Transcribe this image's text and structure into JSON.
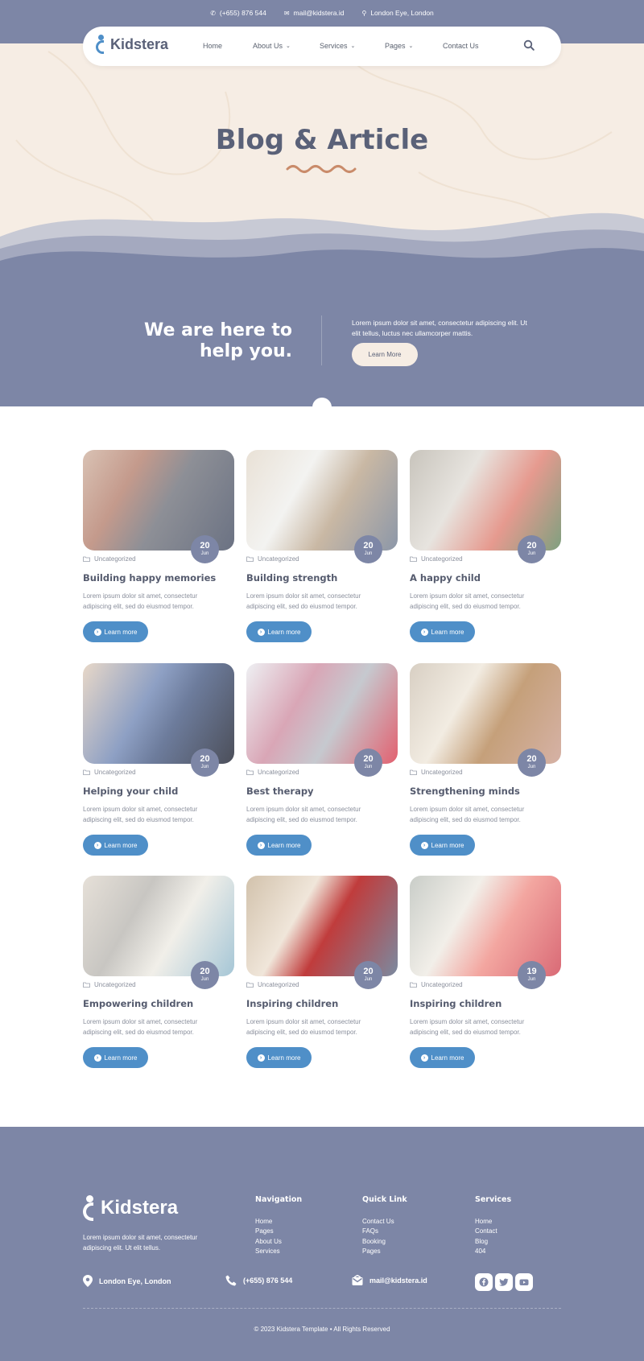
{
  "topbar": {
    "phone": "(+655) 876 544",
    "email": "mail@kidstera.id",
    "location": "London Eye, London"
  },
  "nav": {
    "logo": "Kidstera",
    "items": [
      {
        "label": "Home",
        "has_dropdown": false
      },
      {
        "label": "About Us",
        "has_dropdown": true
      },
      {
        "label": "Services",
        "has_dropdown": true
      },
      {
        "label": "Pages",
        "has_dropdown": true
      },
      {
        "label": "Contact Us",
        "has_dropdown": false
      }
    ]
  },
  "hero": {
    "title": "Blog & Article"
  },
  "band": {
    "heading_line1": "We are here to",
    "heading_line2": "help you.",
    "text": "Lorem ipsum dolor sit amet, consectetur adipiscing elit. Ut elit tellus, luctus nec ullamcorper mattis.",
    "button": "Learn More"
  },
  "posts": [
    {
      "title": "Building happy memories",
      "category": "Uncategorized",
      "day": "20",
      "month": "Jun",
      "excerpt": "Lorem ipsum dolor sit amet, consectetur adipiscing elit, sed do eiusmod tempor.",
      "button": "Learn more"
    },
    {
      "title": "Building strength",
      "category": "Uncategorized",
      "day": "20",
      "month": "Jun",
      "excerpt": "Lorem ipsum dolor sit amet, consectetur adipiscing elit, sed do eiusmod tempor.",
      "button": "Learn more"
    },
    {
      "title": "A happy child",
      "category": "Uncategorized",
      "day": "20",
      "month": "Jun",
      "excerpt": "Lorem ipsum dolor sit amet, consectetur adipiscing elit, sed do eiusmod tempor.",
      "button": "Learn more"
    },
    {
      "title": "Helping your child",
      "category": "Uncategorized",
      "day": "20",
      "month": "Jun",
      "excerpt": "Lorem ipsum dolor sit amet, consectetur adipiscing elit, sed do eiusmod tempor.",
      "button": "Learn more"
    },
    {
      "title": "Best therapy",
      "category": "Uncategorized",
      "day": "20",
      "month": "Jun",
      "excerpt": "Lorem ipsum dolor sit amet, consectetur adipiscing elit, sed do eiusmod tempor.",
      "button": "Learn more"
    },
    {
      "title": "Strengthening minds",
      "category": "Uncategorized",
      "day": "20",
      "month": "Jun",
      "excerpt": "Lorem ipsum dolor sit amet, consectetur adipiscing elit, sed do eiusmod tempor.",
      "button": "Learn more"
    },
    {
      "title": "Empowering children",
      "category": "Uncategorized",
      "day": "20",
      "month": "Jun",
      "excerpt": "Lorem ipsum dolor sit amet, consectetur adipiscing elit, sed do eiusmod tempor.",
      "button": "Learn more"
    },
    {
      "title": "Inspiring children",
      "category": "Uncategorized",
      "day": "20",
      "month": "Jun",
      "excerpt": "Lorem ipsum dolor sit amet, consectetur adipiscing elit, sed do eiusmod tempor.",
      "button": "Learn more"
    },
    {
      "title": "Inspiring children",
      "category": "Uncategorized",
      "day": "19",
      "month": "Jun",
      "excerpt": "Lorem ipsum dolor sit amet, consectetur adipiscing elit, sed do eiusmod tempor.",
      "button": "Learn more"
    }
  ],
  "footer": {
    "logo": "Kidstera",
    "about": "Lorem ipsum dolor sit amet, consectetur adipiscing elit. Ut elit tellus.",
    "navigation": {
      "heading": "Navigation",
      "links": [
        "Home",
        "Pages",
        "About Us",
        "Services"
      ]
    },
    "quick_link": {
      "heading": "Quick Link",
      "links": [
        "Contact Us",
        "FAQs",
        "Booking",
        "Pages"
      ]
    },
    "services": {
      "heading": "Services",
      "links": [
        "Home",
        "Contact",
        "Blog",
        "404"
      ]
    },
    "location": "London Eye, London",
    "phone": "(+655) 876 544",
    "email": "mail@kidstera.id",
    "socials": [
      "facebook-icon",
      "twitter-icon",
      "youtube-icon"
    ],
    "copyright": "© 2023 Kidstera Template • All Rights Reserved"
  },
  "colors": {
    "primary": "#7d86a6",
    "accent": "#4f8fc8",
    "cream": "#f6ede4",
    "heading": "#5a6178"
  }
}
